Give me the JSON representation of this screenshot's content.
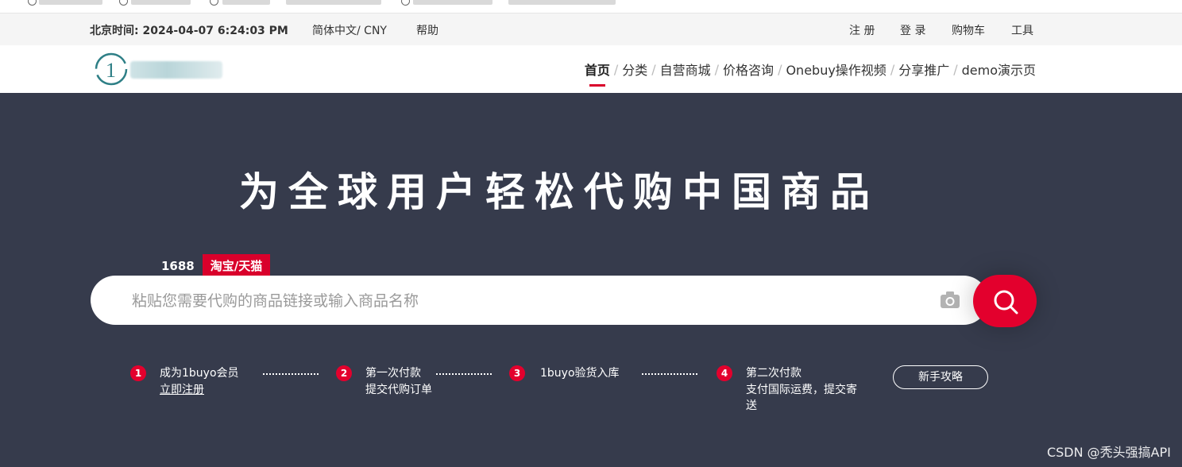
{
  "topbar": {
    "beijing_time": "北京时间:  2024-04-07 6:24:03 PM",
    "language_currency": "简体中文/ CNY",
    "help": "帮助",
    "register": "注 册",
    "login": "登 录",
    "cart": "购物车",
    "tools": "工具"
  },
  "logo": {
    "text": "1"
  },
  "nav": {
    "items": [
      "首页",
      "分类",
      "自营商城",
      "价格咨询",
      "Onebuy操作视频",
      "分享推广",
      "demo演示页"
    ],
    "active_index": 0
  },
  "hero": {
    "headline": "为全球用户轻松代购中国商品",
    "sources": [
      "1688",
      "淘宝/天猫"
    ],
    "active_source": "淘宝/天猫",
    "search_placeholder": "粘贴您需要代购的商品链接或输入商品名称"
  },
  "steps": [
    {
      "num": "1",
      "line1": "成为1buyo会员",
      "line2": "立即注册"
    },
    {
      "num": "2",
      "line1": "第一次付款",
      "line2": "提交代购订单"
    },
    {
      "num": "3",
      "line1": "1buyo验货入库"
    },
    {
      "num": "4",
      "line1": "第二次付款",
      "line2": "支付国际运费，提交寄",
      "line3": "送"
    }
  ],
  "guide_button": "新手攻略",
  "watermark": "CSDN @秃头强搞API",
  "colors": {
    "accent": "#e3002d",
    "hero_bg": "#363b4c",
    "topbar_bg": "#f5f5f5"
  },
  "icons": [
    "camera-icon",
    "search-icon"
  ]
}
